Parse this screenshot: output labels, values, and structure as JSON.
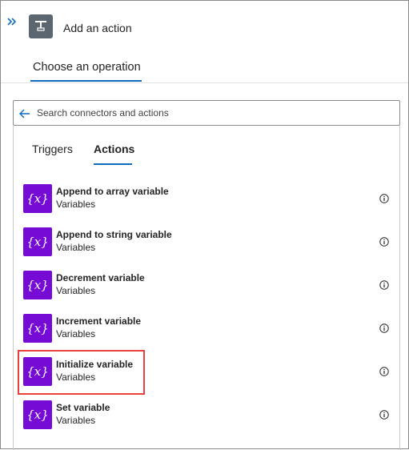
{
  "header": {
    "expand_icon": "double-chevron-right-icon",
    "app_icon": "action-connector-icon",
    "title": "Add an action"
  },
  "operation_tab": {
    "label": "Choose an operation",
    "selected": true
  },
  "search": {
    "icon": "back-arrow-icon",
    "placeholder": "Search connectors and actions",
    "value": ""
  },
  "tabs": [
    {
      "label": "Triggers",
      "selected": false
    },
    {
      "label": "Actions",
      "selected": true
    }
  ],
  "actions": [
    {
      "title": "Append to array variable",
      "subtitle": "Variables",
      "icon": "variable-icon",
      "icon_text": "{x}"
    },
    {
      "title": "Append to string variable",
      "subtitle": "Variables",
      "icon": "variable-icon",
      "icon_text": "{x}"
    },
    {
      "title": "Decrement variable",
      "subtitle": "Variables",
      "icon": "variable-icon",
      "icon_text": "{x}"
    },
    {
      "title": "Increment variable",
      "subtitle": "Variables",
      "icon": "variable-icon",
      "icon_text": "{x}"
    },
    {
      "title": "Initialize variable",
      "subtitle": "Variables",
      "icon": "variable-icon",
      "icon_text": "{x}",
      "highlighted": true
    },
    {
      "title": "Set variable",
      "subtitle": "Variables",
      "icon": "variable-icon",
      "icon_text": "{x}"
    }
  ],
  "colors": {
    "accent": "#0f6cbd",
    "variables_icon_bg": "#770bd6",
    "highlight_border": "#e8413b"
  }
}
